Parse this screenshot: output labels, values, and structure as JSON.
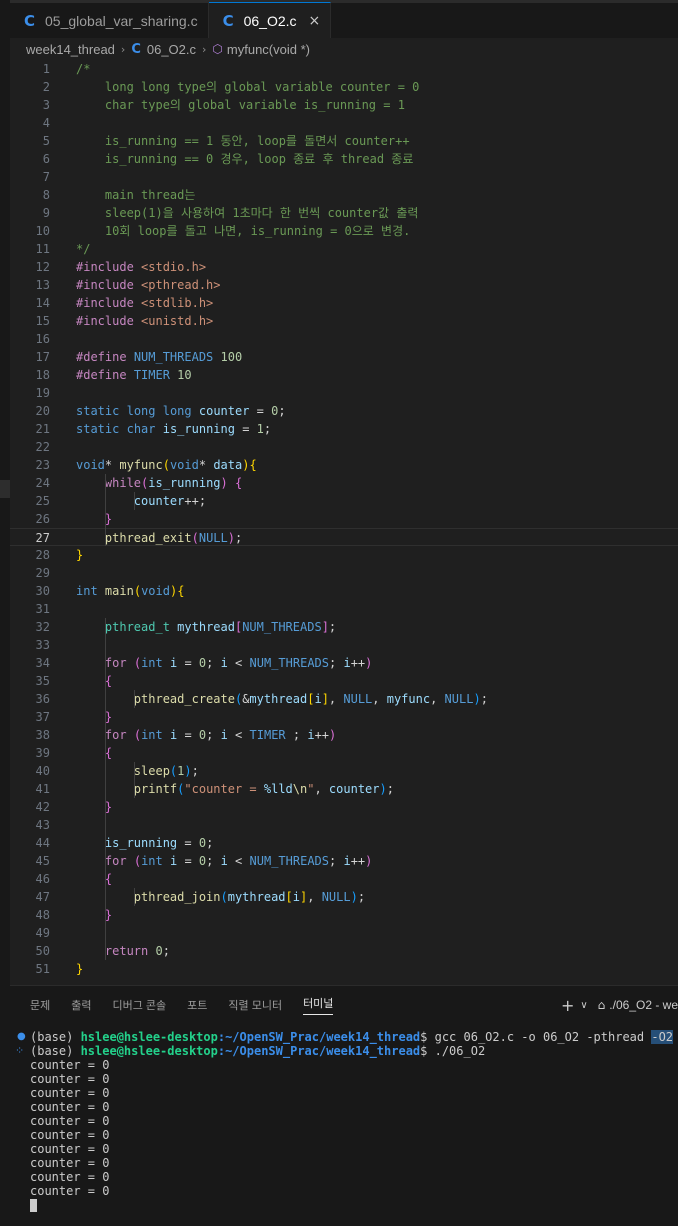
{
  "tabs": [
    {
      "label": "05_global_var_sharing.c",
      "active": false
    },
    {
      "label": "06_O2.c",
      "active": true,
      "close": "×"
    }
  ],
  "breadcrumb": {
    "folder": "week14_thread",
    "file": "06_O2.c",
    "symbol": "myfunc(void *)"
  },
  "editor": {
    "current_line": 27,
    "lines": [
      [
        [
          "cm",
          "/*"
        ]
      ],
      [
        [
          "cm",
          "    long long type의 global variable counter = 0"
        ]
      ],
      [
        [
          "cm",
          "    char type의 global variable is_running = 1"
        ]
      ],
      [],
      [
        [
          "cm",
          "    is_running == 1 동안, loop를 돌면서 counter++"
        ]
      ],
      [
        [
          "cm",
          "    is_running == 0 경우, loop 종료 후 thread 종료"
        ]
      ],
      [],
      [
        [
          "cm",
          "    main thread는"
        ]
      ],
      [
        [
          "cm",
          "    sleep(1)을 사용하여 1초마다 한 번씩 counter값 출력"
        ]
      ],
      [
        [
          "cm",
          "    10회 loop를 돌고 나면, is_running = 0으로 변경."
        ]
      ],
      [
        [
          "cm",
          "*/"
        ]
      ],
      [
        [
          "ctl",
          "#include"
        ],
        [
          "pn",
          " "
        ],
        [
          "str",
          "<stdio.h>"
        ]
      ],
      [
        [
          "ctl",
          "#include"
        ],
        [
          "pn",
          " "
        ],
        [
          "str",
          "<pthread.h>"
        ]
      ],
      [
        [
          "ctl",
          "#include"
        ],
        [
          "pn",
          " "
        ],
        [
          "str",
          "<stdlib.h>"
        ]
      ],
      [
        [
          "ctl",
          "#include"
        ],
        [
          "pn",
          " "
        ],
        [
          "str",
          "<unistd.h>"
        ]
      ],
      [],
      [
        [
          "ctl",
          "#define"
        ],
        [
          "pn",
          " "
        ],
        [
          "mac",
          "NUM_THREADS"
        ],
        [
          "pn",
          " "
        ],
        [
          "num",
          "100"
        ]
      ],
      [
        [
          "ctl",
          "#define"
        ],
        [
          "pn",
          " "
        ],
        [
          "mac",
          "TIMER"
        ],
        [
          "pn",
          " "
        ],
        [
          "num",
          "10"
        ]
      ],
      [],
      [
        [
          "kw",
          "static"
        ],
        [
          "pn",
          " "
        ],
        [
          "kw",
          "long"
        ],
        [
          "pn",
          " "
        ],
        [
          "kw",
          "long"
        ],
        [
          "pn",
          " "
        ],
        [
          "var",
          "counter"
        ],
        [
          "pn",
          " = "
        ],
        [
          "num",
          "0"
        ],
        [
          "pn",
          ";"
        ]
      ],
      [
        [
          "kw",
          "static"
        ],
        [
          "pn",
          " "
        ],
        [
          "kw",
          "char"
        ],
        [
          "pn",
          " "
        ],
        [
          "var",
          "is_running"
        ],
        [
          "pn",
          " = "
        ],
        [
          "num",
          "1"
        ],
        [
          "pn",
          ";"
        ]
      ],
      [],
      [
        [
          "kw",
          "void"
        ],
        [
          "pn",
          "* "
        ],
        [
          "fn",
          "myfunc"
        ],
        [
          "b1",
          "("
        ],
        [
          "kw",
          "void"
        ],
        [
          "pn",
          "* "
        ],
        [
          "var",
          "data"
        ],
        [
          "b1",
          ")"
        ],
        [
          "b1",
          "{"
        ]
      ],
      [
        [
          "pn",
          "    "
        ],
        [
          "ctl",
          "while"
        ],
        [
          "b2",
          "("
        ],
        [
          "var",
          "is_running"
        ],
        [
          "b2",
          ")"
        ],
        [
          "pn",
          " "
        ],
        [
          "b2",
          "{"
        ]
      ],
      [
        [
          "pn",
          "        "
        ],
        [
          "var",
          "counter"
        ],
        [
          "pn",
          "++;"
        ]
      ],
      [
        [
          "pn",
          "    "
        ],
        [
          "b2",
          "}"
        ]
      ],
      [
        [
          "pn",
          "    "
        ],
        [
          "fn",
          "pthread_exit"
        ],
        [
          "b2",
          "("
        ],
        [
          "kw",
          "NULL"
        ],
        [
          "b2",
          ")"
        ],
        [
          "pn",
          ";"
        ]
      ],
      [
        [
          "b1",
          "}"
        ]
      ],
      [],
      [
        [
          "kw",
          "int"
        ],
        [
          "pn",
          " "
        ],
        [
          "fn",
          "main"
        ],
        [
          "b1",
          "("
        ],
        [
          "kw",
          "void"
        ],
        [
          "b1",
          ")"
        ],
        [
          "b1",
          "{"
        ]
      ],
      [],
      [
        [
          "pn",
          "    "
        ],
        [
          "ty",
          "pthread_t"
        ],
        [
          "pn",
          " "
        ],
        [
          "var",
          "mythread"
        ],
        [
          "b2",
          "["
        ],
        [
          "mac",
          "NUM_THREADS"
        ],
        [
          "b2",
          "]"
        ],
        [
          "pn",
          ";"
        ]
      ],
      [],
      [
        [
          "pn",
          "    "
        ],
        [
          "ctl",
          "for"
        ],
        [
          "pn",
          " "
        ],
        [
          "b2",
          "("
        ],
        [
          "kw",
          "int"
        ],
        [
          "pn",
          " "
        ],
        [
          "var",
          "i"
        ],
        [
          "pn",
          " = "
        ],
        [
          "num",
          "0"
        ],
        [
          "pn",
          "; "
        ],
        [
          "var",
          "i"
        ],
        [
          "pn",
          " < "
        ],
        [
          "mac",
          "NUM_THREADS"
        ],
        [
          "pn",
          "; "
        ],
        [
          "var",
          "i"
        ],
        [
          "pn",
          "++"
        ],
        [
          "b2",
          ")"
        ]
      ],
      [
        [
          "pn",
          "    "
        ],
        [
          "b2",
          "{"
        ]
      ],
      [
        [
          "pn",
          "        "
        ],
        [
          "fn",
          "pthread_create"
        ],
        [
          "b3",
          "("
        ],
        [
          "pn",
          "&"
        ],
        [
          "var",
          "mythread"
        ],
        [
          "b1",
          "["
        ],
        [
          "var",
          "i"
        ],
        [
          "b1",
          "]"
        ],
        [
          "pn",
          ", "
        ],
        [
          "kw",
          "NULL"
        ],
        [
          "pn",
          ", "
        ],
        [
          "var",
          "myfunc"
        ],
        [
          "pn",
          ", "
        ],
        [
          "kw",
          "NULL"
        ],
        [
          "b3",
          ")"
        ],
        [
          "pn",
          ";"
        ]
      ],
      [
        [
          "pn",
          "    "
        ],
        [
          "b2",
          "}"
        ]
      ],
      [
        [
          "pn",
          "    "
        ],
        [
          "ctl",
          "for"
        ],
        [
          "pn",
          " "
        ],
        [
          "b2",
          "("
        ],
        [
          "kw",
          "int"
        ],
        [
          "pn",
          " "
        ],
        [
          "var",
          "i"
        ],
        [
          "pn",
          " = "
        ],
        [
          "num",
          "0"
        ],
        [
          "pn",
          "; "
        ],
        [
          "var",
          "i"
        ],
        [
          "pn",
          " < "
        ],
        [
          "mac",
          "TIMER"
        ],
        [
          "pn",
          " ; "
        ],
        [
          "var",
          "i"
        ],
        [
          "pn",
          "++"
        ],
        [
          "b2",
          ")"
        ]
      ],
      [
        [
          "pn",
          "    "
        ],
        [
          "b2",
          "{"
        ]
      ],
      [
        [
          "pn",
          "        "
        ],
        [
          "fn",
          "sleep"
        ],
        [
          "b3",
          "("
        ],
        [
          "num",
          "1"
        ],
        [
          "b3",
          ")"
        ],
        [
          "pn",
          ";"
        ]
      ],
      [
        [
          "pn",
          "        "
        ],
        [
          "fn",
          "printf"
        ],
        [
          "b3",
          "("
        ],
        [
          "str",
          "\"counter = "
        ],
        [
          "var",
          "%lld"
        ],
        [
          "fn",
          "\\n"
        ],
        [
          "str",
          "\""
        ],
        [
          "pn",
          ", "
        ],
        [
          "var",
          "counter"
        ],
        [
          "b3",
          ")"
        ],
        [
          "pn",
          ";"
        ]
      ],
      [
        [
          "pn",
          "    "
        ],
        [
          "b2",
          "}"
        ]
      ],
      [],
      [
        [
          "pn",
          "    "
        ],
        [
          "var",
          "is_running"
        ],
        [
          "pn",
          " = "
        ],
        [
          "num",
          "0"
        ],
        [
          "pn",
          ";"
        ]
      ],
      [
        [
          "pn",
          "    "
        ],
        [
          "ctl",
          "for"
        ],
        [
          "pn",
          " "
        ],
        [
          "b2",
          "("
        ],
        [
          "kw",
          "int"
        ],
        [
          "pn",
          " "
        ],
        [
          "var",
          "i"
        ],
        [
          "pn",
          " = "
        ],
        [
          "num",
          "0"
        ],
        [
          "pn",
          "; "
        ],
        [
          "var",
          "i"
        ],
        [
          "pn",
          " < "
        ],
        [
          "mac",
          "NUM_THREADS"
        ],
        [
          "pn",
          "; "
        ],
        [
          "var",
          "i"
        ],
        [
          "pn",
          "++"
        ],
        [
          "b2",
          ")"
        ]
      ],
      [
        [
          "pn",
          "    "
        ],
        [
          "b2",
          "{"
        ]
      ],
      [
        [
          "pn",
          "        "
        ],
        [
          "fn",
          "pthread_join"
        ],
        [
          "b3",
          "("
        ],
        [
          "var",
          "mythread"
        ],
        [
          "b1",
          "["
        ],
        [
          "var",
          "i"
        ],
        [
          "b1",
          "]"
        ],
        [
          "pn",
          ", "
        ],
        [
          "kw",
          "NULL"
        ],
        [
          "b3",
          ")"
        ],
        [
          "pn",
          ";"
        ]
      ],
      [
        [
          "pn",
          "    "
        ],
        [
          "b2",
          "}"
        ]
      ],
      [],
      [
        [
          "pn",
          "    "
        ],
        [
          "ctl",
          "return"
        ],
        [
          "pn",
          " "
        ],
        [
          "num",
          "0"
        ],
        [
          "pn",
          ";"
        ]
      ],
      [
        [
          "b1",
          "}"
        ]
      ]
    ]
  },
  "panel": {
    "tabs": [
      "문제",
      "출력",
      "디버그 콘솔",
      "포트",
      "직렬 모니터",
      "터미널"
    ],
    "active_tab": "터미널",
    "add_icon": "+",
    "dropdown_icon": "∨",
    "terminal_label": "./06_O2 - we"
  },
  "terminal": {
    "commands": [
      {
        "marker": "dot",
        "prefix": "(base) ",
        "user": "hslee@hslee-desktop",
        "path": ":~/OpenSW_Prac/week14_thread",
        "prompt": "$ ",
        "cmd": "gcc 06_O2.c -o 06_O2 -pthread ",
        "selected": "-O2"
      },
      {
        "marker": "star",
        "prefix": "(base) ",
        "user": "hslee@hslee-desktop",
        "path": ":~/OpenSW_Prac/week14_thread",
        "prompt": "$ ",
        "cmd": "./06_O2",
        "selected": ""
      }
    ],
    "output": [
      "counter = 0",
      "counter = 0",
      "counter = 0",
      "counter = 0",
      "counter = 0",
      "counter = 0",
      "counter = 0",
      "counter = 0",
      "counter = 0",
      "counter = 0"
    ]
  }
}
